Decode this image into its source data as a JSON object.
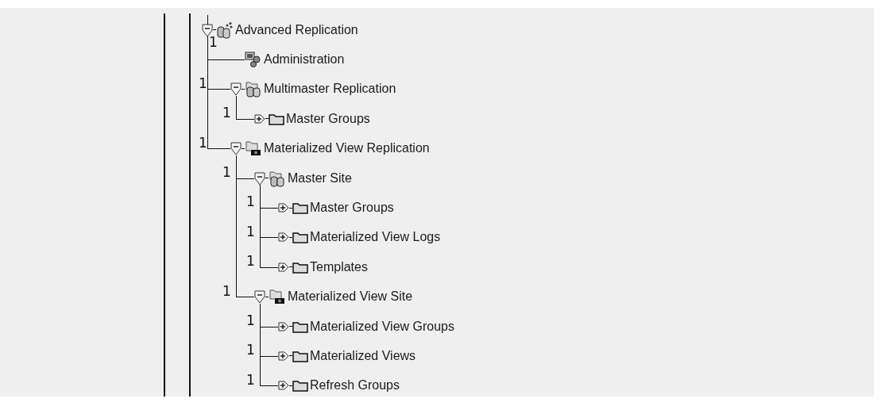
{
  "tree": [
    {
      "label": "Advanced Replication",
      "kind": "replication",
      "expanded": true,
      "callout": "1",
      "children": [
        {
          "label": "Administration",
          "kind": "admin"
        },
        {
          "label": "Multimaster Replication",
          "kind": "database-folder",
          "expanded": true,
          "callout": "1",
          "children": [
            {
              "label": "Master Groups",
              "kind": "folder",
              "expanded": false,
              "callout": "1"
            }
          ]
        },
        {
          "label": "Materialized View Replication",
          "kind": "mview-folder",
          "expanded": true,
          "callout": "1",
          "children": [
            {
              "label": "Master Site",
              "kind": "database-folder",
              "expanded": true,
              "callout": "1",
              "children": [
                {
                  "label": "Master Groups",
                  "kind": "folder",
                  "expanded": false,
                  "callout": "1"
                },
                {
                  "label": "Materialized View Logs",
                  "kind": "folder",
                  "expanded": false,
                  "callout": "1"
                },
                {
                  "label": "Templates",
                  "kind": "folder",
                  "expanded": false,
                  "callout": "1"
                }
              ]
            },
            {
              "label": "Materialized View Site",
              "kind": "mview-folder",
              "expanded": true,
              "callout": "1",
              "children": [
                {
                  "label": "Materialized View Groups",
                  "kind": "folder",
                  "expanded": false,
                  "callout": "1"
                },
                {
                  "label": "Materialized Views",
                  "kind": "folder",
                  "expanded": false,
                  "callout": "1"
                },
                {
                  "label": "Refresh Groups",
                  "kind": "folder",
                  "expanded": false,
                  "callout": "1"
                }
              ]
            }
          ]
        }
      ]
    }
  ]
}
